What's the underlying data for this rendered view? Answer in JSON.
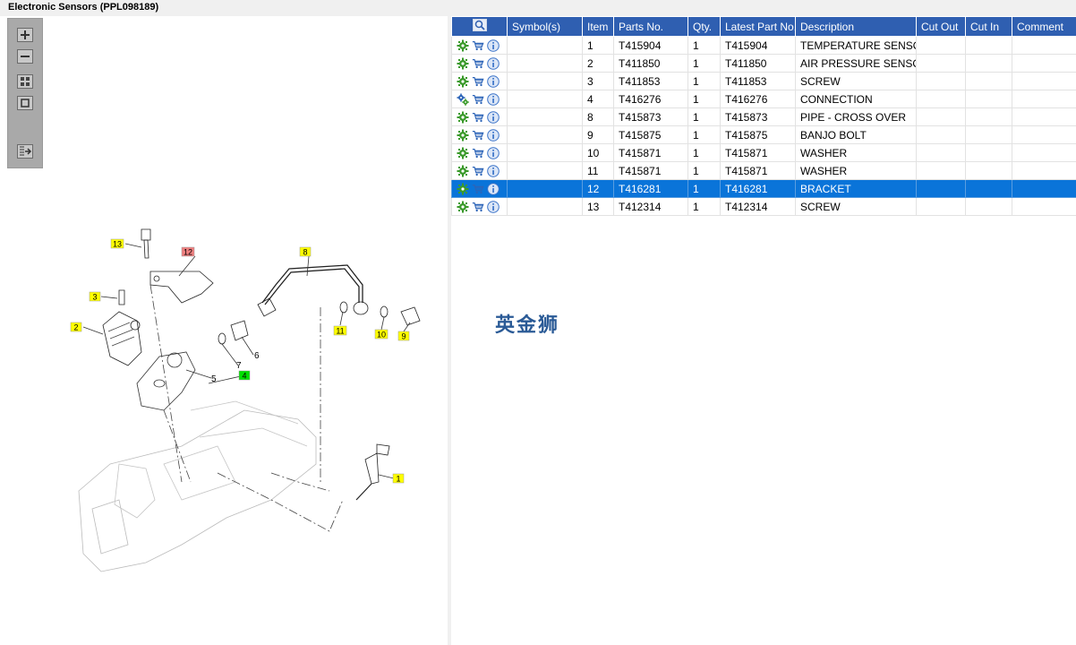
{
  "window": {
    "title": "Electronic Sensors (PPL098189)"
  },
  "toolbox": {
    "tools": [
      {
        "name": "zoom-in-icon"
      },
      {
        "name": "zoom-out-icon"
      },
      {
        "name": "fit-all-icon"
      },
      {
        "name": "actual-size-icon"
      },
      {
        "name": "export-icon"
      }
    ]
  },
  "diagram": {
    "callouts": [
      {
        "label": "13",
        "color": "#ffff00"
      },
      {
        "label": "12",
        "color": "#f08080"
      },
      {
        "label": "8",
        "color": "#ffff00"
      },
      {
        "label": "3",
        "color": "#ffff00"
      },
      {
        "label": "2",
        "color": "#ffff00"
      },
      {
        "label": "11",
        "color": "#ffff00"
      },
      {
        "label": "10",
        "color": "#ffff00"
      },
      {
        "label": "9",
        "color": "#ffff00"
      },
      {
        "label": "4",
        "color": "#00e000"
      },
      {
        "label": "1",
        "color": "#ffff00"
      }
    ],
    "plain_labels": [
      "7",
      "6",
      "5"
    ]
  },
  "table": {
    "columns": [
      "",
      "Symbol(s)",
      "Item",
      "Parts No.",
      "Qty.",
      "Latest Part No.",
      "Description",
      "Cut Out",
      "Cut In",
      "Comment"
    ],
    "rows": [
      {
        "symbol": "",
        "item": "1",
        "parts_no": "T415904",
        "qty": "1",
        "latest": "T415904",
        "desc": "TEMPERATURE SENSOR",
        "cut_out": "",
        "cut_in": "",
        "comment": "",
        "gear": "single",
        "selected": false
      },
      {
        "symbol": "",
        "item": "2",
        "parts_no": "T411850",
        "qty": "1",
        "latest": "T411850",
        "desc": "AIR PRESSURE SENSOR",
        "cut_out": "",
        "cut_in": "",
        "comment": "",
        "gear": "single",
        "selected": false
      },
      {
        "symbol": "",
        "item": "3",
        "parts_no": "T411853",
        "qty": "1",
        "latest": "T411853",
        "desc": "SCREW",
        "cut_out": "",
        "cut_in": "",
        "comment": "",
        "gear": "single",
        "selected": false
      },
      {
        "symbol": "",
        "item": "4",
        "parts_no": "T416276",
        "qty": "1",
        "latest": "T416276",
        "desc": "CONNECTION",
        "cut_out": "",
        "cut_in": "",
        "comment": "",
        "gear": "multi",
        "selected": false
      },
      {
        "symbol": "",
        "item": "8",
        "parts_no": "T415873",
        "qty": "1",
        "latest": "T415873",
        "desc": "PIPE - CROSS OVER",
        "cut_out": "",
        "cut_in": "",
        "comment": "",
        "gear": "single",
        "selected": false
      },
      {
        "symbol": "",
        "item": "9",
        "parts_no": "T415875",
        "qty": "1",
        "latest": "T415875",
        "desc": "BANJO BOLT",
        "cut_out": "",
        "cut_in": "",
        "comment": "",
        "gear": "single",
        "selected": false
      },
      {
        "symbol": "",
        "item": "10",
        "parts_no": "T415871",
        "qty": "1",
        "latest": "T415871",
        "desc": "WASHER",
        "cut_out": "",
        "cut_in": "",
        "comment": "",
        "gear": "single",
        "selected": false
      },
      {
        "symbol": "",
        "item": "11",
        "parts_no": "T415871",
        "qty": "1",
        "latest": "T415871",
        "desc": "WASHER",
        "cut_out": "",
        "cut_in": "",
        "comment": "",
        "gear": "single",
        "selected": false
      },
      {
        "symbol": "",
        "item": "12",
        "parts_no": "T416281",
        "qty": "1",
        "latest": "T416281",
        "desc": "BRACKET",
        "cut_out": "",
        "cut_in": "",
        "comment": "",
        "gear": "single",
        "selected": true
      },
      {
        "symbol": "",
        "item": "13",
        "parts_no": "T412314",
        "qty": "1",
        "latest": "T412314",
        "desc": "SCREW",
        "cut_out": "",
        "cut_in": "",
        "comment": "",
        "gear": "single",
        "selected": false
      }
    ]
  },
  "watermark": {
    "text": "英金狮"
  },
  "colors": {
    "header": "#2f5fb1",
    "selected_row": "#0a74d9",
    "gear": "#3a9a2a",
    "cart": "#2c64b8",
    "info": "#3b73c8"
  }
}
